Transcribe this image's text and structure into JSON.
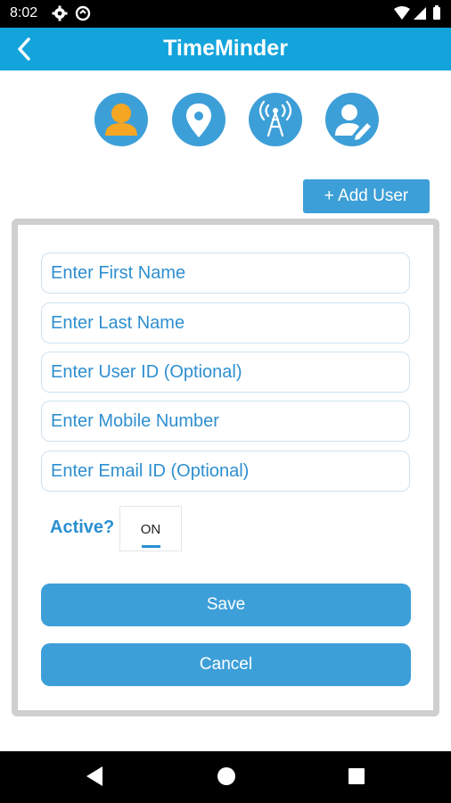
{
  "status_bar": {
    "time": "8:02"
  },
  "app": {
    "title": "TimeMinder"
  },
  "toolbar": {
    "add_user_label": "+ Add User"
  },
  "form": {
    "first_name_placeholder": "Enter First Name",
    "last_name_placeholder": "Enter Last Name",
    "user_id_placeholder": "Enter User ID (Optional)",
    "mobile_placeholder": "Enter Mobile Number",
    "email_placeholder": "Enter Email ID (Optional)",
    "active_label": "Active?",
    "active_toggle_text": "ON",
    "save_label": "Save",
    "cancel_label": "Cancel"
  },
  "icons": {
    "tabs": [
      "user-icon",
      "location-pin-icon",
      "signal-tower-icon",
      "edit-user-icon"
    ]
  },
  "colors": {
    "app_bar": "#13a4dc",
    "accent": "#3d9fd8",
    "active_user_icon": "#f5a623",
    "placeholder_text": "#2e8fcf"
  }
}
